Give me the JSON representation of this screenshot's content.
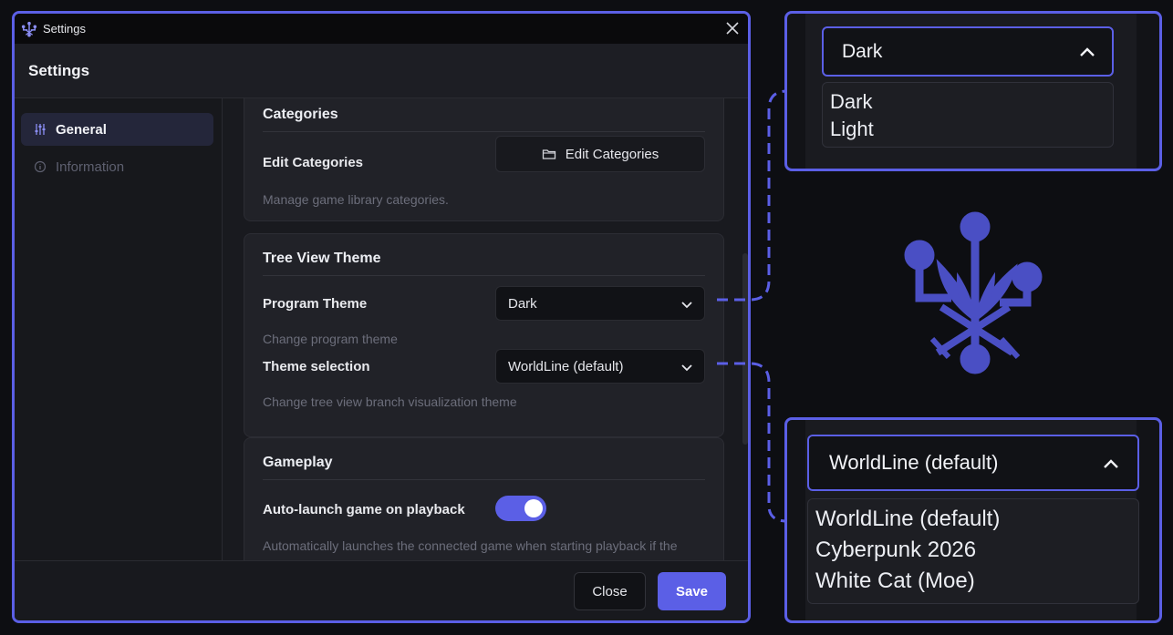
{
  "window": {
    "titlebar_title": "Settings",
    "header_title": "Settings"
  },
  "sidebar": {
    "items": [
      {
        "label": "General",
        "icon": "sliders-icon",
        "active": true
      },
      {
        "label": "Information",
        "icon": "info-icon",
        "active": false
      }
    ]
  },
  "sections": {
    "categories": {
      "title": "Categories",
      "edit_label": "Edit Categories",
      "edit_button": "Edit Categories",
      "edit_hint": "Manage game library categories."
    },
    "tree_view": {
      "title": "Tree View Theme",
      "program_theme_label": "Program Theme",
      "program_theme_value": "Dark",
      "program_theme_hint": "Change program theme",
      "theme_selection_label": "Theme selection",
      "theme_selection_value": "WorldLine (default)",
      "theme_selection_hint": "Change tree view branch visualization theme"
    },
    "gameplay": {
      "title": "Gameplay",
      "autolaunch_label": "Auto-launch game on playback",
      "autolaunch_on": true,
      "autolaunch_hint": "Automatically launches the connected game when starting playback if the"
    }
  },
  "footer": {
    "close_label": "Close",
    "save_label": "Save"
  },
  "callouts": {
    "program_theme": {
      "selected": "Dark",
      "options": [
        "Dark",
        "Light"
      ]
    },
    "theme_selection": {
      "selected": "WorldLine (default)",
      "options": [
        "WorldLine (default)",
        "Cyberpunk 2026",
        "White Cat (Moe)"
      ]
    }
  },
  "colors": {
    "accent": "#5b5fe6",
    "background": "#0d0e12",
    "panel": "#212228"
  }
}
